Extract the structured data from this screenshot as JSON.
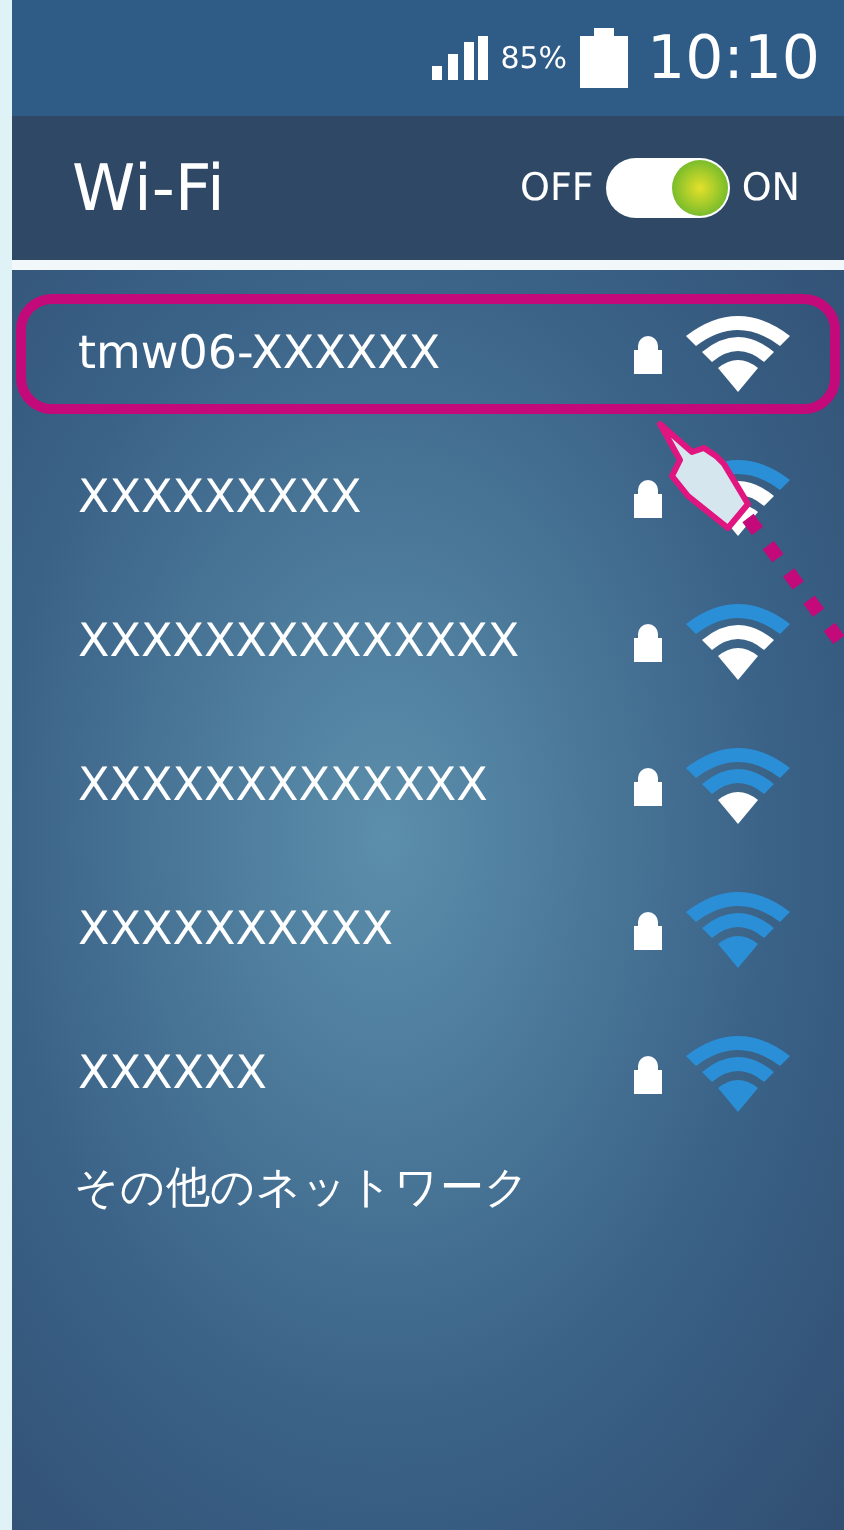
{
  "status_bar": {
    "battery_percent": "85%",
    "time": "10:10"
  },
  "header": {
    "title": "Wi-Fi",
    "toggle": {
      "off_label": "OFF",
      "on_label": "ON",
      "on": true
    }
  },
  "networks": [
    {
      "name": "tmw06-XXXXXX",
      "locked": true,
      "kind": "full",
      "selected": true
    },
    {
      "name": "XXXXXXXXX",
      "locked": true,
      "kind": "high",
      "selected": false
    },
    {
      "name": "XXXXXXXXXXXXXX",
      "locked": true,
      "kind": "high",
      "selected": false
    },
    {
      "name": "XXXXXXXXXXXXX",
      "locked": true,
      "kind": "medium",
      "selected": false
    },
    {
      "name": "XXXXXXXXXX",
      "locked": true,
      "kind": "low",
      "selected": false
    },
    {
      "name": "XXXXXX",
      "locked": true,
      "kind": "low",
      "selected": false
    }
  ],
  "other_networks": "その他のネットワーク"
}
